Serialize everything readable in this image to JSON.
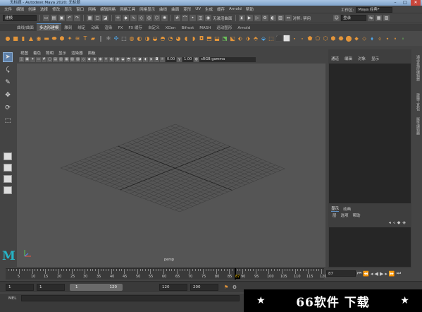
{
  "window": {
    "title": "无标题 - Autodesk Maya 2020: 无标题",
    "minimize": "–",
    "maximize": "□",
    "close": "✕"
  },
  "menu": [
    "文件",
    "编辑",
    "创建",
    "选择",
    "修改",
    "显示",
    "窗口",
    "网格",
    "编辑网格",
    "网格工具",
    "网格显示",
    "曲线",
    "曲面",
    "变形",
    "UV",
    "生成",
    "缓存",
    "Arnold",
    "帮助"
  ],
  "workspace": {
    "label": "工作区:",
    "value": "Maya 经典*"
  },
  "status": {
    "mode": "建模",
    "no_live": "无激活曲面",
    "symmetry": "对称: 禁用",
    "login": "登录"
  },
  "shelf_tabs": [
    {
      "label": "曲线/曲面"
    },
    {
      "label": "多边形建模",
      "active": true
    },
    {
      "label": "雕刻"
    },
    {
      "label": "绑定"
    },
    {
      "label": "动画"
    },
    {
      "label": "渲染"
    },
    {
      "label": "FX"
    },
    {
      "label": "FX 缓存"
    },
    {
      "label": "自定义"
    },
    {
      "label": "XGen"
    },
    {
      "label": "Bifrost"
    },
    {
      "label": "MASH"
    },
    {
      "label": "运动图形"
    },
    {
      "label": "Arnold"
    }
  ],
  "viewport": {
    "menu": [
      "视图",
      "着色",
      "照明",
      "显示",
      "渲染器",
      "面板"
    ],
    "camera": "persp",
    "exposure": "0.00",
    "gamma": "1.00",
    "colorspace": "sRGB gamma"
  },
  "right_panel": {
    "menu": [
      "通道",
      "编辑",
      "对象",
      "显示"
    ],
    "layer_tabs": [
      "显示",
      "动画"
    ],
    "layer_menu": [
      "层",
      "选项",
      "帮助"
    ],
    "vertical_tabs": [
      "通道盒/层编辑器",
      "建模工具包",
      "属性编辑器"
    ]
  },
  "timeline": {
    "labels": [
      "5",
      "10",
      "15",
      "20",
      "25",
      "30",
      "35",
      "40",
      "45",
      "50",
      "55",
      "60",
      "65",
      "70",
      "75",
      "80",
      "85",
      "90",
      "95",
      "100",
      "105",
      "110",
      "115",
      "120"
    ],
    "current": "87",
    "end": "87"
  },
  "range": {
    "start": "1",
    "start2": "1",
    "slider_start": "1",
    "slider_end": "120",
    "end": "120",
    "end2": "200"
  },
  "mel": {
    "label": "MEL"
  },
  "watermark": {
    "text": "66软件 下载"
  },
  "logo": {
    "letter": "M"
  },
  "colors": {
    "shelf_orange": "#e3953a",
    "accent_blue": "#5f92c7",
    "maya_teal": "#26b4c6"
  }
}
